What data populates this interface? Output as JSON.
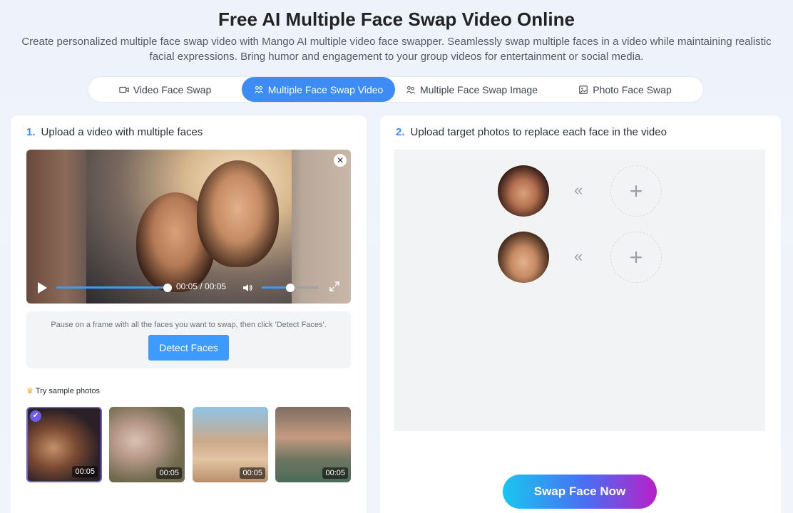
{
  "header": {
    "title": "Free AI Multiple Face Swap Video Online",
    "subtitle": "Create personalized multiple face swap video with Mango AI multiple video face swapper. Seamlessly swap multiple faces in a video while maintaining realistic facial expressions. Bring humor and engagement to your group videos for entertainment or social media."
  },
  "tabs": [
    {
      "label": "Video Face Swap",
      "icon": "video-camera-icon",
      "active": false
    },
    {
      "label": "Multiple Face Swap Video",
      "icon": "group-faces-icon",
      "active": true
    },
    {
      "label": "Multiple Face Swap Image",
      "icon": "group-image-icon",
      "active": false
    },
    {
      "label": "Photo Face Swap",
      "icon": "image-icon",
      "active": false
    }
  ],
  "left": {
    "step_num": "1.",
    "step_title": "Upload a video with multiple faces",
    "player": {
      "time": "00:05 / 00:05",
      "progress": 1.0,
      "volume": 0.5
    },
    "detect_hint": "Pause on a frame with all the faces you want to swap, then click 'Detect Faces'.",
    "detect_button": "Detect Faces",
    "samples_label": "Try sample photos",
    "samples": [
      {
        "duration": "00:05",
        "selected": true
      },
      {
        "duration": "00:05",
        "selected": false
      },
      {
        "duration": "00:05",
        "selected": false
      },
      {
        "duration": "00:05",
        "selected": false
      }
    ]
  },
  "right": {
    "step_num": "2.",
    "step_title": "Upload target photos to replace each face in the video",
    "swap_button": "Swap Face Now"
  },
  "colors": {
    "accent": "#3d8cf5",
    "button_blue": "#3d9bff",
    "selected_border": "#6c5ce7"
  }
}
